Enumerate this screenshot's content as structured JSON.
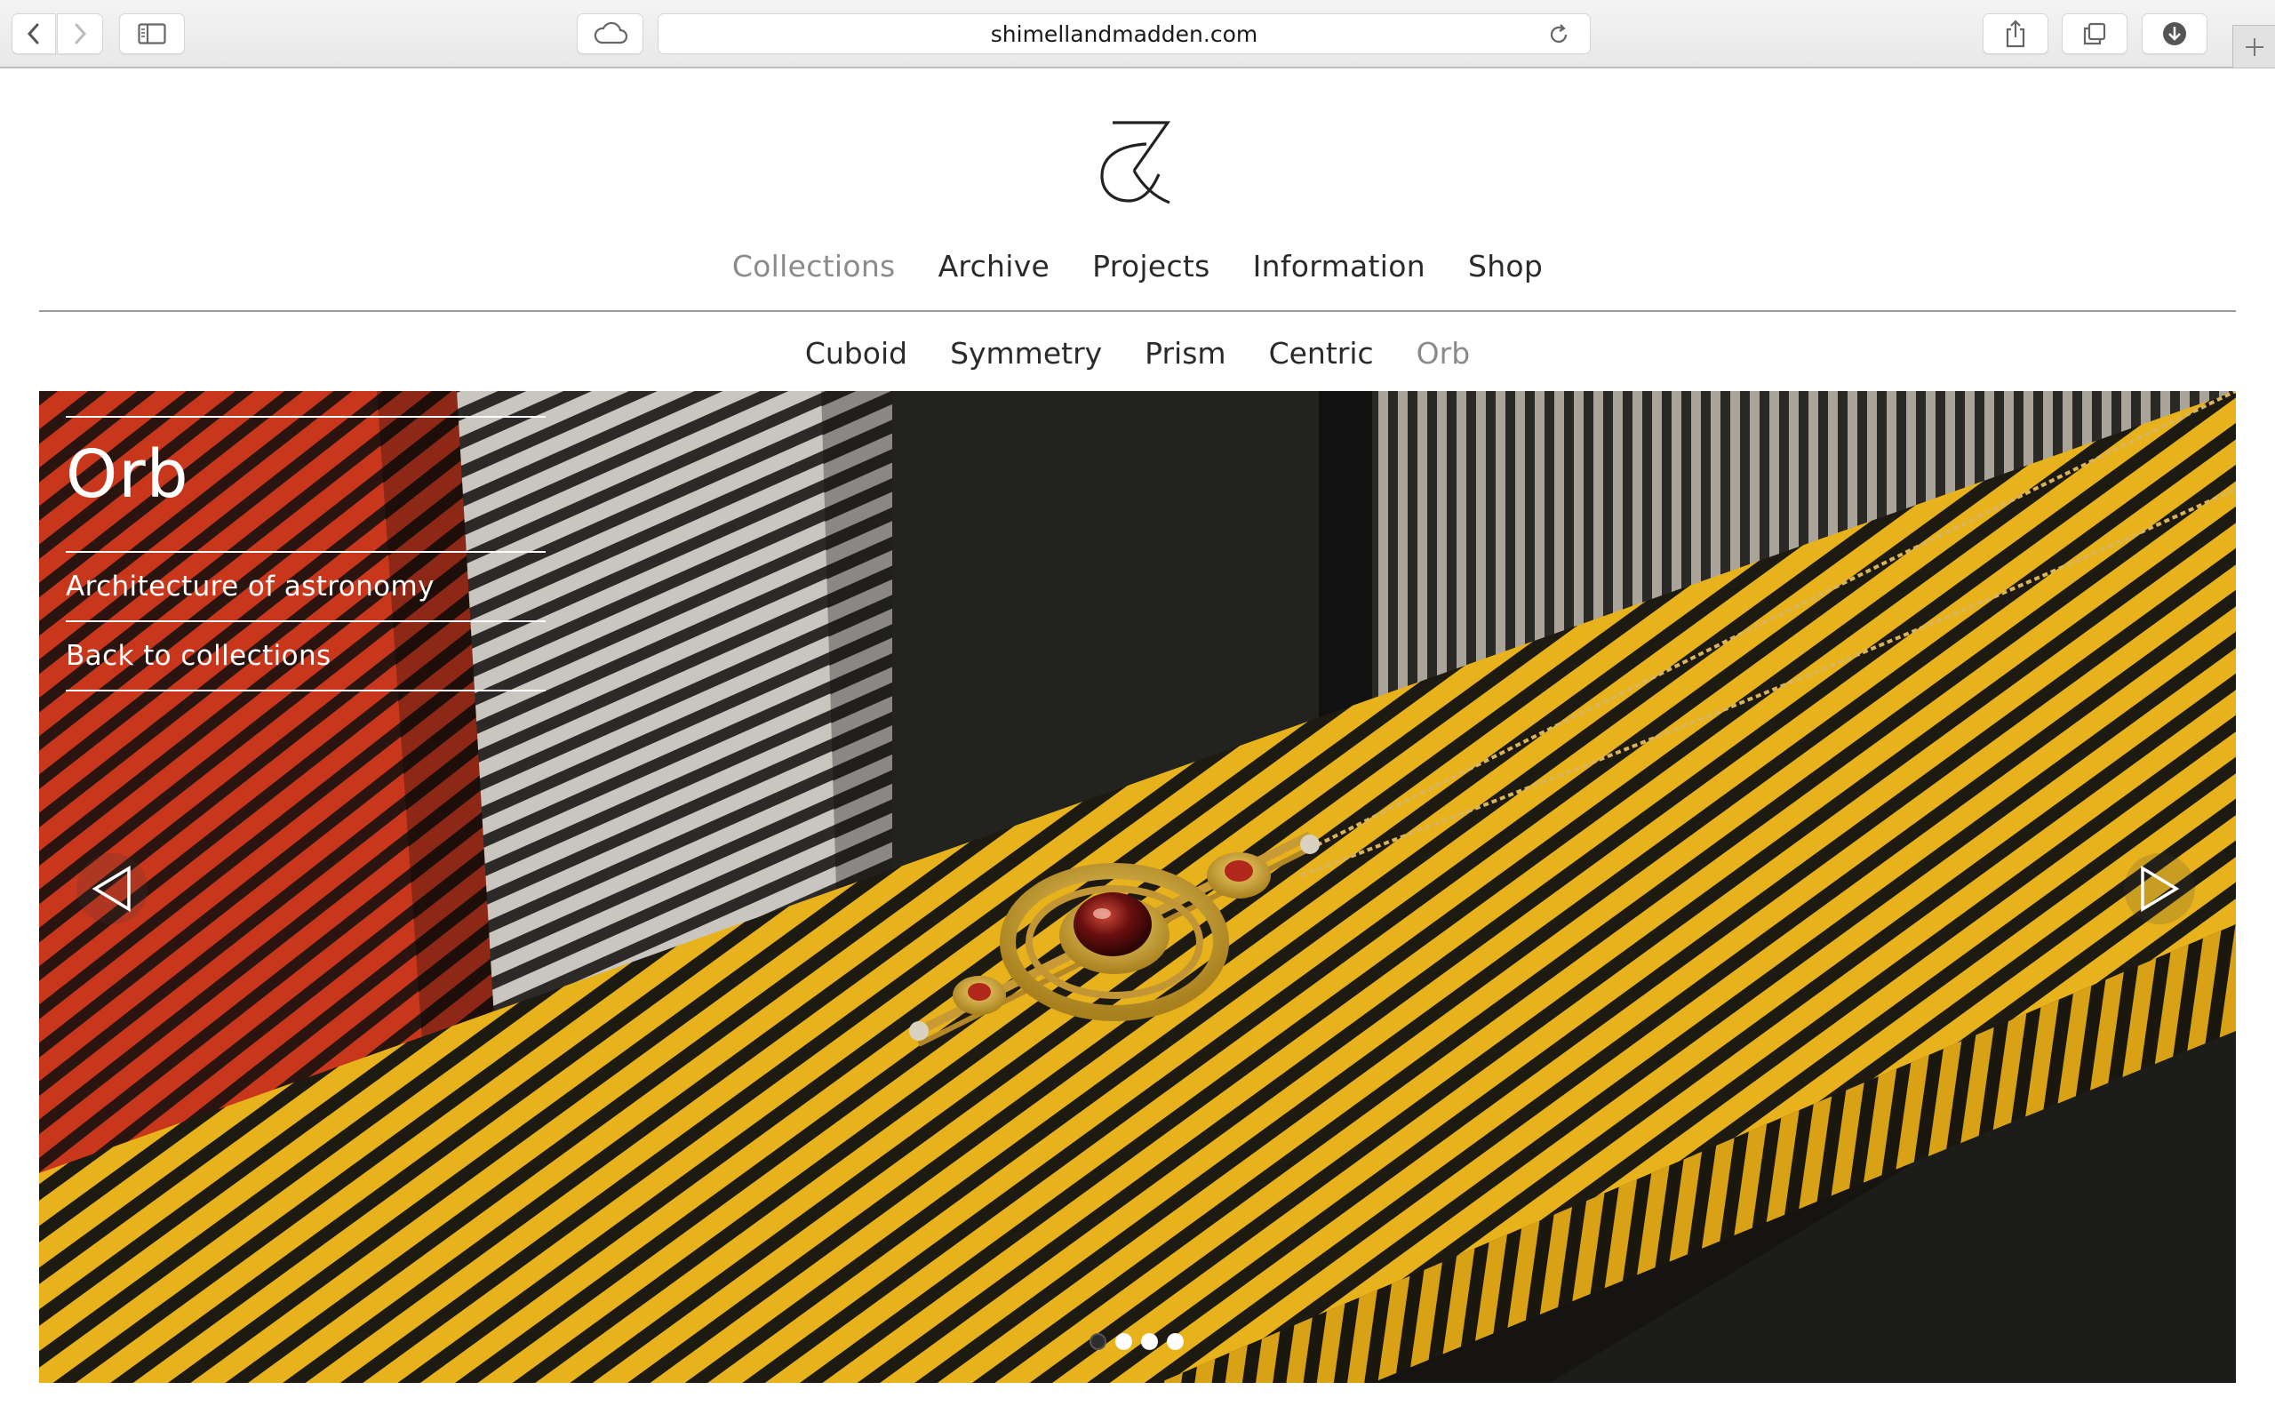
{
  "browser": {
    "url": "shimellandmadden.com"
  },
  "site": {
    "main_nav": [
      {
        "label": "Collections",
        "active": true
      },
      {
        "label": "Archive",
        "active": false
      },
      {
        "label": "Projects",
        "active": false
      },
      {
        "label": "Information",
        "active": false
      },
      {
        "label": "Shop",
        "active": false
      }
    ],
    "sub_nav": [
      {
        "label": "Cuboid",
        "active": false
      },
      {
        "label": "Symmetry",
        "active": false
      },
      {
        "label": "Prism",
        "active": false
      },
      {
        "label": "Centric",
        "active": false
      },
      {
        "label": "Orb",
        "active": true
      }
    ]
  },
  "hero": {
    "title": "Orb",
    "subtitle": "Architecture of astronomy",
    "back_link": "Back to collections",
    "slide_count": 4,
    "current_slide": 1
  },
  "icons": [
    "back-icon",
    "forward-icon",
    "sidebar-icon",
    "icloud-icon",
    "reload-icon",
    "share-icon",
    "tabs-icon",
    "download-icon",
    "new-tab-icon",
    "logo-ampersand",
    "prev-arrow-icon",
    "next-arrow-icon"
  ]
}
